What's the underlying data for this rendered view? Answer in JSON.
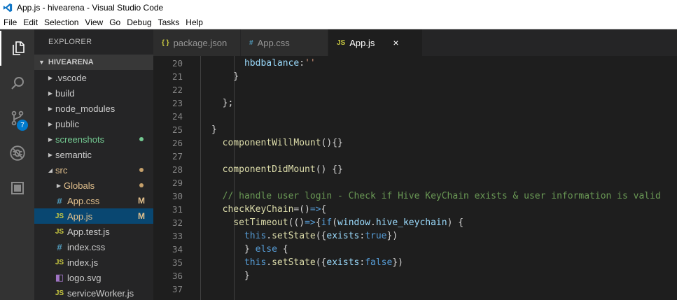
{
  "window": {
    "title": "App.js - hivearena - Visual Studio Code"
  },
  "menu": [
    "File",
    "Edit",
    "Selection",
    "View",
    "Go",
    "Debug",
    "Tasks",
    "Help"
  ],
  "activity": {
    "source_control_badge": "7"
  },
  "sidebar": {
    "header": "EXPLORER",
    "section": "HIVEARENA",
    "items": [
      {
        "label": ".vscode",
        "kind": "folder",
        "expanded": false,
        "indent": 0,
        "color": "#cccccc"
      },
      {
        "label": "build",
        "kind": "folder",
        "expanded": false,
        "indent": 0,
        "color": "#cccccc"
      },
      {
        "label": "node_modules",
        "kind": "folder",
        "expanded": false,
        "indent": 0,
        "color": "#cccccc"
      },
      {
        "label": "public",
        "kind": "folder",
        "expanded": false,
        "indent": 0,
        "color": "#cccccc"
      },
      {
        "label": "screenshots",
        "kind": "folder",
        "expanded": false,
        "indent": 0,
        "color": "#73c991",
        "dot": "#73c991"
      },
      {
        "label": "semantic",
        "kind": "folder",
        "expanded": false,
        "indent": 0,
        "color": "#cccccc"
      },
      {
        "label": "src",
        "kind": "folder",
        "expanded": true,
        "indent": 0,
        "color": "#e2c08d",
        "dot": "#c5a06a"
      },
      {
        "label": "Globals",
        "kind": "folder",
        "expanded": false,
        "indent": 1,
        "color": "#e2c08d",
        "dot": "#c5a06a"
      },
      {
        "label": "App.css",
        "kind": "css",
        "indent": 1,
        "color": "#e2c08d",
        "status": "M"
      },
      {
        "label": "App.js",
        "kind": "js",
        "indent": 1,
        "color": "#e2c08d",
        "status": "M",
        "selected": true
      },
      {
        "label": "App.test.js",
        "kind": "js",
        "indent": 1,
        "color": "#cccccc"
      },
      {
        "label": "index.css",
        "kind": "css",
        "indent": 1,
        "color": "#cccccc"
      },
      {
        "label": "index.js",
        "kind": "js",
        "indent": 1,
        "color": "#cccccc"
      },
      {
        "label": "logo.svg",
        "kind": "svg",
        "indent": 1,
        "color": "#cccccc"
      },
      {
        "label": "serviceWorker.js",
        "kind": "js",
        "indent": 1,
        "color": "#cccccc"
      }
    ]
  },
  "tabs": [
    {
      "label": "package.json",
      "icon": "{ }",
      "icon_color": "#cbcb41",
      "active": false
    },
    {
      "label": "App.css",
      "icon": "#",
      "icon_color": "#519aba",
      "active": false
    },
    {
      "label": "App.js",
      "icon": "JS",
      "icon_color": "#cbcb41",
      "active": true,
      "close": "×"
    }
  ],
  "editor": {
    "lines": [
      {
        "n": "20",
        "tokens": [
          [
            "      ",
            "pl"
          ],
          [
            "hbdbalance",
            "var"
          ],
          [
            ":",
            "pl"
          ],
          [
            "''",
            "str"
          ]
        ]
      },
      {
        "n": "21",
        "tokens": [
          [
            "    }",
            "pl"
          ]
        ]
      },
      {
        "n": "22",
        "tokens": []
      },
      {
        "n": "23",
        "tokens": [
          [
            "  };",
            "pl"
          ]
        ]
      },
      {
        "n": "24",
        "tokens": []
      },
      {
        "n": "25",
        "tokens": [
          [
            "}",
            "pl"
          ]
        ]
      },
      {
        "n": "26",
        "tokens": [
          [
            "  ",
            "pl"
          ],
          [
            "componentWillMount",
            "fn"
          ],
          [
            "(){}",
            "pl"
          ]
        ]
      },
      {
        "n": "27",
        "tokens": []
      },
      {
        "n": "28",
        "tokens": [
          [
            "  ",
            "pl"
          ],
          [
            "componentDidMount",
            "fn"
          ],
          [
            "() {}",
            "pl"
          ]
        ]
      },
      {
        "n": "29",
        "tokens": []
      },
      {
        "n": "30",
        "tokens": [
          [
            "  // handle user login - Check if Hive KeyChain exists & user information is valid",
            "com"
          ]
        ]
      },
      {
        "n": "31",
        "tokens": [
          [
            "  ",
            "pl"
          ],
          [
            "checkKeyChain",
            "fn"
          ],
          [
            "=",
            "pl"
          ],
          [
            "()",
            "pl"
          ],
          [
            "=>",
            "kw"
          ],
          [
            "{",
            "pl"
          ]
        ]
      },
      {
        "n": "32",
        "tokens": [
          [
            "    ",
            "pl"
          ],
          [
            "setTimeout",
            "fn"
          ],
          [
            "(()",
            "pl"
          ],
          [
            "=>",
            "kw"
          ],
          [
            "{",
            "pl"
          ],
          [
            "if",
            "kw"
          ],
          [
            "(",
            "pl"
          ],
          [
            "window",
            "var"
          ],
          [
            ".",
            "pl"
          ],
          [
            "hive_keychain",
            "var"
          ],
          [
            ") {",
            "pl"
          ]
        ]
      },
      {
        "n": "33",
        "tokens": [
          [
            "      ",
            "pl"
          ],
          [
            "this",
            "kw"
          ],
          [
            ".",
            "pl"
          ],
          [
            "setState",
            "fn"
          ],
          [
            "({",
            "pl"
          ],
          [
            "exists",
            "var"
          ],
          [
            ":",
            "pl"
          ],
          [
            "true",
            "kw"
          ],
          [
            "})",
            "pl"
          ]
        ]
      },
      {
        "n": "34",
        "tokens": [
          [
            "      } ",
            "pl"
          ],
          [
            "else",
            "kw"
          ],
          [
            " {",
            "pl"
          ]
        ]
      },
      {
        "n": "35",
        "tokens": [
          [
            "      ",
            "pl"
          ],
          [
            "this",
            "kw"
          ],
          [
            ".",
            "pl"
          ],
          [
            "setState",
            "fn"
          ],
          [
            "({",
            "pl"
          ],
          [
            "exists",
            "var"
          ],
          [
            ":",
            "pl"
          ],
          [
            "false",
            "kw"
          ],
          [
            "})",
            "pl"
          ]
        ]
      },
      {
        "n": "36",
        "tokens": [
          [
            "      }",
            "pl"
          ]
        ]
      },
      {
        "n": "37",
        "tokens": []
      }
    ]
  }
}
